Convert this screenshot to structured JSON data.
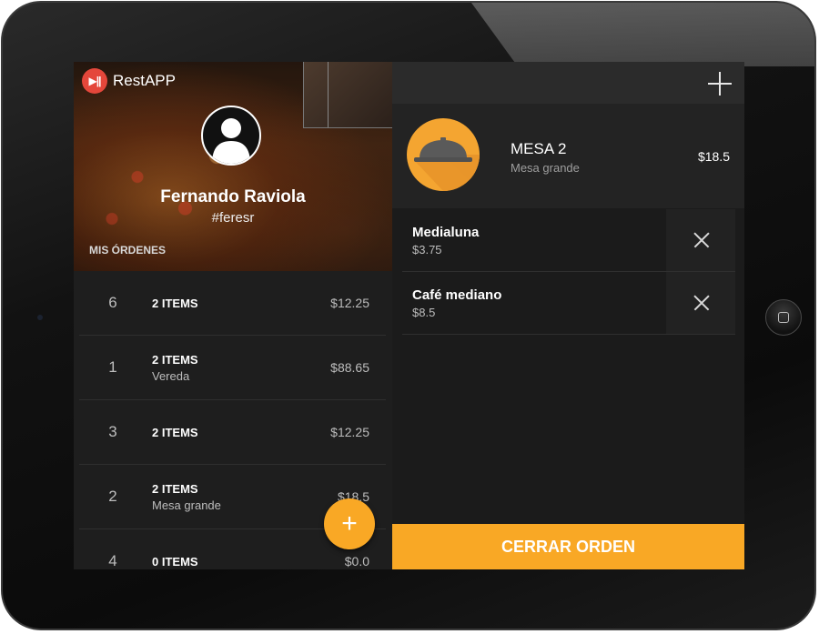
{
  "app": {
    "name": "RestAPP",
    "logo_glyph": "▶||"
  },
  "profile": {
    "name": "Fernando Raviola",
    "handle": "#feresr",
    "section_label": "MIS ÓRDENES"
  },
  "orders": [
    {
      "number": "6",
      "items": "2 ITEMS",
      "subtitle": "",
      "price": "$12.25"
    },
    {
      "number": "1",
      "items": "2 ITEMS",
      "subtitle": "Vereda",
      "price": "$88.65"
    },
    {
      "number": "3",
      "items": "2 ITEMS",
      "subtitle": "",
      "price": "$12.25"
    },
    {
      "number": "2",
      "items": "2 ITEMS",
      "subtitle": "Mesa grande",
      "price": "$18.5"
    },
    {
      "number": "4",
      "items": "0 ITEMS",
      "subtitle": "",
      "price": "$0.0"
    }
  ],
  "fab": {
    "icon": "plus-icon",
    "glyph": "+"
  },
  "table": {
    "title": "MESA 2",
    "subtitle": "Mesa grande",
    "total": "$18.5",
    "icon": "cloche-icon"
  },
  "order_items": [
    {
      "name": "Medialuna",
      "price": "$3.75"
    },
    {
      "name": "Café mediano",
      "price": "$8.5"
    }
  ],
  "actions": {
    "close_order": "CERRAR ORDEN"
  },
  "colors": {
    "accent": "#f9a825",
    "logo": "#e4473b",
    "background": "#1b1b1b"
  }
}
